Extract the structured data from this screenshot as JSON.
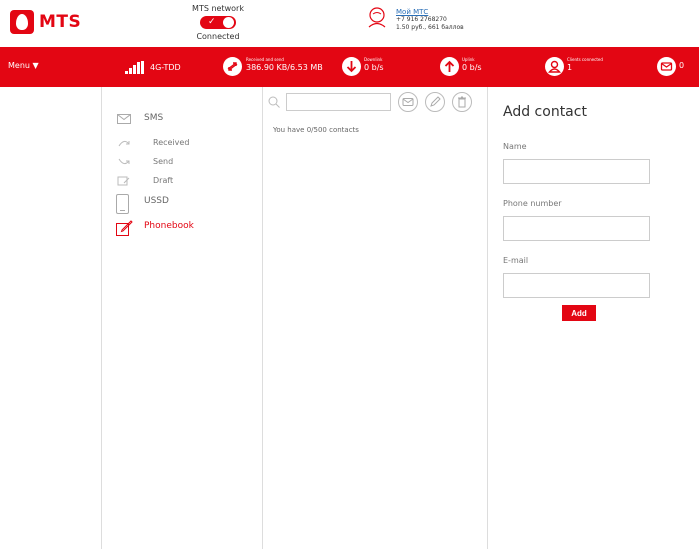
{
  "header": {
    "brand": "MTS",
    "network_label": "MTS network",
    "network_status": "Connected",
    "account_link": "Мой МТС",
    "phone": "+7 916 2768270",
    "balance": "1.50 руб., 661 баллов"
  },
  "statusbar": {
    "menu_label": "Menu ▼",
    "signal_type": "4G-TDD",
    "traffic_label": "Received and send",
    "traffic_value": "386.90 KB/6.53 MB",
    "downlink_label": "Downlink",
    "downlink_value": "0 b/s",
    "uplink_label": "Uplink",
    "uplink_value": "0 b/s",
    "clients_label": "Clients connected",
    "clients_value": "1",
    "messages_count": "0"
  },
  "sidebar": {
    "sms": "SMS",
    "received": "Received",
    "send": "Send",
    "draft": "Draft",
    "ussd": "USSD",
    "phonebook": "Phonebook"
  },
  "contacts": {
    "count_text": "You have 0/500 contacts"
  },
  "add_contact": {
    "title": "Add contact",
    "name_label": "Name",
    "phone_label": "Phone number",
    "email_label": "E-mail",
    "add_button": "Add"
  },
  "colors": {
    "accent": "#e30613"
  }
}
